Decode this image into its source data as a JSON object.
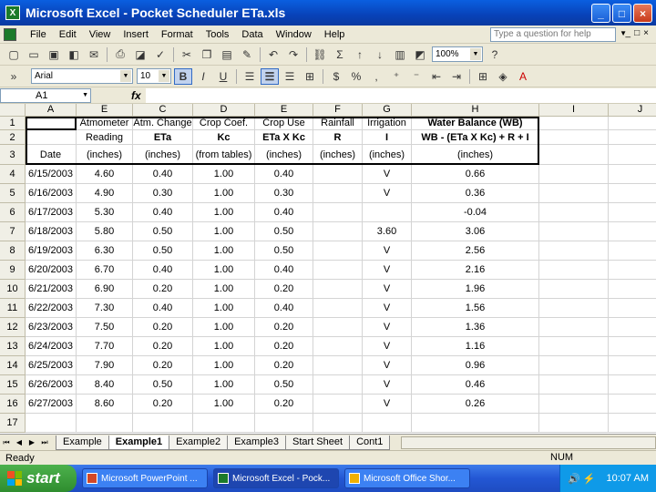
{
  "window": {
    "title": "Microsoft Excel - Pocket Scheduler ETa.xls"
  },
  "menu": {
    "items": [
      "File",
      "Edit",
      "View",
      "Insert",
      "Format",
      "Tools",
      "Data",
      "Window",
      "Help"
    ],
    "help_placeholder": "Type a question for help"
  },
  "toolbar": {
    "zoom": "100%",
    "font": "Arial",
    "font_size": "10",
    "bold": "B"
  },
  "formula_bar": {
    "name_box": "A1",
    "fx": "fx",
    "formula": ""
  },
  "columns": [
    "A",
    "B",
    "C",
    "D",
    "E",
    "F",
    "G",
    "H",
    "I",
    "J"
  ],
  "column_display": [
    "A",
    "E",
    "C",
    "D",
    "E",
    "F",
    "G",
    "H",
    "I",
    "J"
  ],
  "header_rows": [
    [
      "",
      "Atmometer",
      "Atm. Change",
      "Crop Coef.",
      "Crop Use",
      "Rainfall",
      "Irrigation",
      "Water Balance (WB)"
    ],
    [
      "",
      "Reading",
      "ETa",
      "Kc",
      "ETa X Kc",
      "R",
      "I",
      "WB - (ETa X Kc) + R + I"
    ],
    [
      "Date",
      "(inches)",
      "(inches)",
      "(from tables)",
      "(inches)",
      "(inches)",
      "(inches)",
      "(inches)"
    ]
  ],
  "data_rows": [
    [
      "6/15/2003",
      "4.60",
      "0.40",
      "1.00",
      "0.40",
      "",
      "V",
      "0.66"
    ],
    [
      "6/16/2003",
      "4.90",
      "0.30",
      "1.00",
      "0.30",
      "",
      "V",
      "0.36"
    ],
    [
      "6/17/2003",
      "5.30",
      "0.40",
      "1.00",
      "0.40",
      "",
      "",
      "-0.04"
    ],
    [
      "6/18/2003",
      "5.80",
      "0.50",
      "1.00",
      "0.50",
      "",
      "3.60",
      "3.06"
    ],
    [
      "6/19/2003",
      "6.30",
      "0.50",
      "1.00",
      "0.50",
      "",
      "V",
      "2.56"
    ],
    [
      "6/20/2003",
      "6.70",
      "0.40",
      "1.00",
      "0.40",
      "",
      "V",
      "2.16"
    ],
    [
      "6/21/2003",
      "6.90",
      "0.20",
      "1.00",
      "0.20",
      "",
      "V",
      "1.96"
    ],
    [
      "6/22/2003",
      "7.30",
      "0.40",
      "1.00",
      "0.40",
      "",
      "V",
      "1.56"
    ],
    [
      "6/23/2003",
      "7.50",
      "0.20",
      "1.00",
      "0.20",
      "",
      "V",
      "1.36"
    ],
    [
      "6/24/2003",
      "7.70",
      "0.20",
      "1.00",
      "0.20",
      "",
      "V",
      "1.16"
    ],
    [
      "6/25/2003",
      "7.90",
      "0.20",
      "1.00",
      "0.20",
      "",
      "V",
      "0.96"
    ],
    [
      "6/26/2003",
      "8.40",
      "0.50",
      "1.00",
      "0.50",
      "",
      "V",
      "0.46"
    ],
    [
      "6/27/2003",
      "8.60",
      "0.20",
      "1.00",
      "0.20",
      "",
      "V",
      "0.26"
    ]
  ],
  "row_numbers": [
    "1",
    "2",
    "3",
    "4",
    "5",
    "6",
    "7",
    "8",
    "9",
    "10",
    "11",
    "12",
    "13",
    "14",
    "15",
    "16",
    "17"
  ],
  "sheet_tabs": [
    "Example",
    "Example1",
    "Example2",
    "Example3",
    "Start Sheet",
    "Cont1"
  ],
  "active_tab": "Example1",
  "status": {
    "left": "Ready",
    "num": "NUM"
  },
  "taskbar": {
    "start": "start",
    "buttons": [
      "Microsoft PowerPoint ...",
      "Microsoft Excel - Pock...",
      "Microsoft Office Shor..."
    ],
    "clock": "10:07 AM"
  }
}
